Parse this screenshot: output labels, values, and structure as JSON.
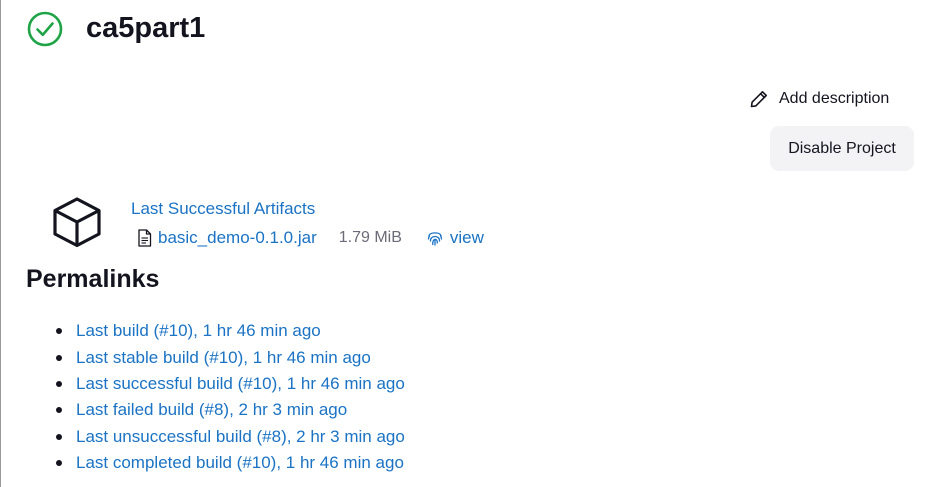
{
  "job": {
    "name": "ca5part1",
    "status_icon": "check-circle-icon",
    "status_color": "#1ea446"
  },
  "actions": {
    "add_description": "Add description",
    "disable_project": "Disable Project"
  },
  "artifacts": {
    "heading": "Last Successful Artifacts",
    "file_name": "basic_demo-0.1.0.jar",
    "file_size": "1.79 MiB",
    "view_label": "view"
  },
  "permalinks": {
    "heading": "Permalinks",
    "items": [
      "Last build (#10), 1 hr 46 min ago",
      "Last stable build (#10), 1 hr 46 min ago",
      "Last successful build (#10), 1 hr 46 min ago",
      "Last failed build (#8), 2 hr 3 min ago",
      "Last unsuccessful build (#8), 2 hr 3 min ago",
      "Last completed build (#10), 1 hr 46 min ago"
    ]
  },
  "colors": {
    "link": "#1a73c4",
    "text": "#14141f",
    "muted": "#6b6b78",
    "button_bg": "#f3f3f6"
  }
}
